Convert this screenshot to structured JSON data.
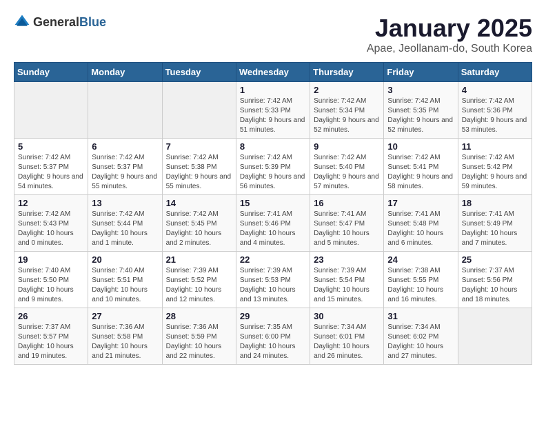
{
  "header": {
    "logo_general": "General",
    "logo_blue": "Blue",
    "title": "January 2025",
    "subtitle": "Apae, Jeollanam-do, South Korea"
  },
  "weekdays": [
    "Sunday",
    "Monday",
    "Tuesday",
    "Wednesday",
    "Thursday",
    "Friday",
    "Saturday"
  ],
  "weeks": [
    [
      {
        "day": "",
        "info": ""
      },
      {
        "day": "",
        "info": ""
      },
      {
        "day": "",
        "info": ""
      },
      {
        "day": "1",
        "info": "Sunrise: 7:42 AM\nSunset: 5:33 PM\nDaylight: 9 hours and 51 minutes."
      },
      {
        "day": "2",
        "info": "Sunrise: 7:42 AM\nSunset: 5:34 PM\nDaylight: 9 hours and 52 minutes."
      },
      {
        "day": "3",
        "info": "Sunrise: 7:42 AM\nSunset: 5:35 PM\nDaylight: 9 hours and 52 minutes."
      },
      {
        "day": "4",
        "info": "Sunrise: 7:42 AM\nSunset: 5:36 PM\nDaylight: 9 hours and 53 minutes."
      }
    ],
    [
      {
        "day": "5",
        "info": "Sunrise: 7:42 AM\nSunset: 5:37 PM\nDaylight: 9 hours and 54 minutes."
      },
      {
        "day": "6",
        "info": "Sunrise: 7:42 AM\nSunset: 5:37 PM\nDaylight: 9 hours and 55 minutes."
      },
      {
        "day": "7",
        "info": "Sunrise: 7:42 AM\nSunset: 5:38 PM\nDaylight: 9 hours and 55 minutes."
      },
      {
        "day": "8",
        "info": "Sunrise: 7:42 AM\nSunset: 5:39 PM\nDaylight: 9 hours and 56 minutes."
      },
      {
        "day": "9",
        "info": "Sunrise: 7:42 AM\nSunset: 5:40 PM\nDaylight: 9 hours and 57 minutes."
      },
      {
        "day": "10",
        "info": "Sunrise: 7:42 AM\nSunset: 5:41 PM\nDaylight: 9 hours and 58 minutes."
      },
      {
        "day": "11",
        "info": "Sunrise: 7:42 AM\nSunset: 5:42 PM\nDaylight: 9 hours and 59 minutes."
      }
    ],
    [
      {
        "day": "12",
        "info": "Sunrise: 7:42 AM\nSunset: 5:43 PM\nDaylight: 10 hours and 0 minutes."
      },
      {
        "day": "13",
        "info": "Sunrise: 7:42 AM\nSunset: 5:44 PM\nDaylight: 10 hours and 1 minute."
      },
      {
        "day": "14",
        "info": "Sunrise: 7:42 AM\nSunset: 5:45 PM\nDaylight: 10 hours and 2 minutes."
      },
      {
        "day": "15",
        "info": "Sunrise: 7:41 AM\nSunset: 5:46 PM\nDaylight: 10 hours and 4 minutes."
      },
      {
        "day": "16",
        "info": "Sunrise: 7:41 AM\nSunset: 5:47 PM\nDaylight: 10 hours and 5 minutes."
      },
      {
        "day": "17",
        "info": "Sunrise: 7:41 AM\nSunset: 5:48 PM\nDaylight: 10 hours and 6 minutes."
      },
      {
        "day": "18",
        "info": "Sunrise: 7:41 AM\nSunset: 5:49 PM\nDaylight: 10 hours and 7 minutes."
      }
    ],
    [
      {
        "day": "19",
        "info": "Sunrise: 7:40 AM\nSunset: 5:50 PM\nDaylight: 10 hours and 9 minutes."
      },
      {
        "day": "20",
        "info": "Sunrise: 7:40 AM\nSunset: 5:51 PM\nDaylight: 10 hours and 10 minutes."
      },
      {
        "day": "21",
        "info": "Sunrise: 7:39 AM\nSunset: 5:52 PM\nDaylight: 10 hours and 12 minutes."
      },
      {
        "day": "22",
        "info": "Sunrise: 7:39 AM\nSunset: 5:53 PM\nDaylight: 10 hours and 13 minutes."
      },
      {
        "day": "23",
        "info": "Sunrise: 7:39 AM\nSunset: 5:54 PM\nDaylight: 10 hours and 15 minutes."
      },
      {
        "day": "24",
        "info": "Sunrise: 7:38 AM\nSunset: 5:55 PM\nDaylight: 10 hours and 16 minutes."
      },
      {
        "day": "25",
        "info": "Sunrise: 7:37 AM\nSunset: 5:56 PM\nDaylight: 10 hours and 18 minutes."
      }
    ],
    [
      {
        "day": "26",
        "info": "Sunrise: 7:37 AM\nSunset: 5:57 PM\nDaylight: 10 hours and 19 minutes."
      },
      {
        "day": "27",
        "info": "Sunrise: 7:36 AM\nSunset: 5:58 PM\nDaylight: 10 hours and 21 minutes."
      },
      {
        "day": "28",
        "info": "Sunrise: 7:36 AM\nSunset: 5:59 PM\nDaylight: 10 hours and 22 minutes."
      },
      {
        "day": "29",
        "info": "Sunrise: 7:35 AM\nSunset: 6:00 PM\nDaylight: 10 hours and 24 minutes."
      },
      {
        "day": "30",
        "info": "Sunrise: 7:34 AM\nSunset: 6:01 PM\nDaylight: 10 hours and 26 minutes."
      },
      {
        "day": "31",
        "info": "Sunrise: 7:34 AM\nSunset: 6:02 PM\nDaylight: 10 hours and 27 minutes."
      },
      {
        "day": "",
        "info": ""
      }
    ]
  ]
}
